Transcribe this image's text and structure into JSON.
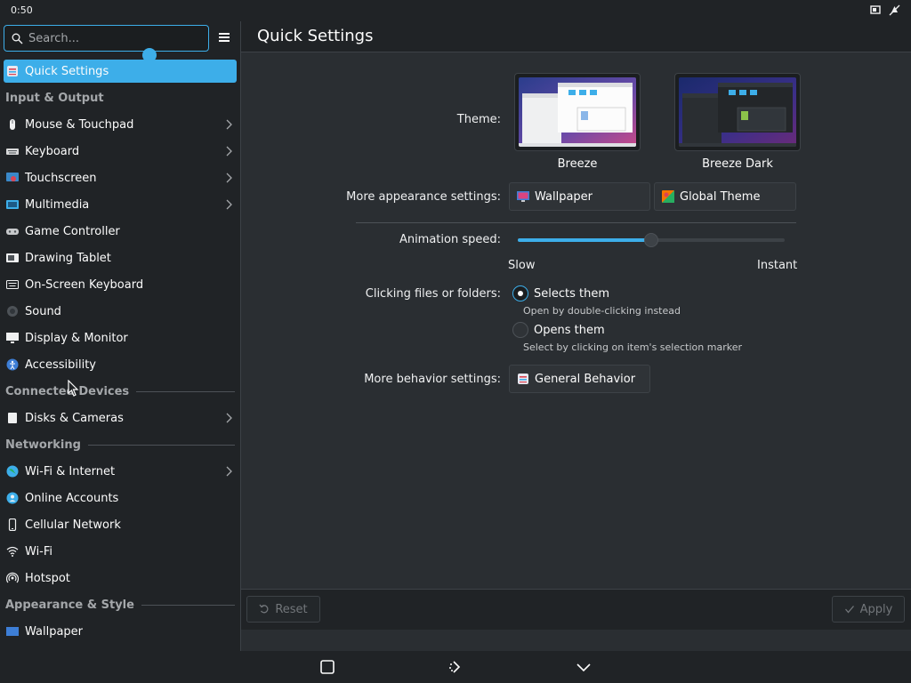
{
  "status": {
    "time": "0:50",
    "tray": [
      "screen-icon",
      "bell-off-icon"
    ]
  },
  "sidebar": {
    "search_placeholder": "Search...",
    "selected": {
      "label": "Quick Settings",
      "icon": "quick-settings-icon"
    },
    "sections": [
      {
        "header": "Input & Output",
        "items": [
          {
            "label": "Mouse & Touchpad",
            "icon": "mouse-icon",
            "chevron": true
          },
          {
            "label": "Keyboard",
            "icon": "keyboard-icon",
            "chevron": true
          },
          {
            "label": "Touchscreen",
            "icon": "touchscreen-icon",
            "chevron": true
          },
          {
            "label": "Multimedia",
            "icon": "multimedia-icon",
            "chevron": true
          },
          {
            "label": "Game Controller",
            "icon": "gamepad-icon",
            "chevron": false
          },
          {
            "label": "Drawing Tablet",
            "icon": "tablet-icon",
            "chevron": false
          },
          {
            "label": "On-Screen Keyboard",
            "icon": "onscreen-keyboard-icon",
            "chevron": false
          },
          {
            "label": "Sound",
            "icon": "speaker-icon",
            "chevron": false
          },
          {
            "label": "Display & Monitor",
            "icon": "monitor-icon",
            "chevron": false
          },
          {
            "label": "Accessibility",
            "icon": "accessibility-icon",
            "chevron": false
          }
        ]
      },
      {
        "header": "Connected Devices",
        "items": [
          {
            "label": "Disks & Cameras",
            "icon": "disk-icon",
            "chevron": true
          }
        ]
      },
      {
        "header": "Networking",
        "items": [
          {
            "label": "Wi-Fi & Internet",
            "icon": "globe-icon",
            "chevron": true
          },
          {
            "label": "Online Accounts",
            "icon": "online-accounts-icon",
            "chevron": false
          },
          {
            "label": "Cellular Network",
            "icon": "phone-icon",
            "chevron": false
          },
          {
            "label": "Wi-Fi",
            "icon": "wifi-icon",
            "chevron": false
          },
          {
            "label": "Hotspot",
            "icon": "hotspot-icon",
            "chevron": false
          }
        ]
      },
      {
        "header": "Appearance & Style",
        "items": [
          {
            "label": "Wallpaper",
            "icon": "wallpaper-icon",
            "chevron": false
          }
        ]
      }
    ]
  },
  "main": {
    "title": "Quick Settings",
    "theme_label": "Theme:",
    "themes": [
      {
        "name": "Breeze"
      },
      {
        "name": "Breeze Dark"
      }
    ],
    "appearance_label": "More appearance settings:",
    "wallpaper_button": "Wallpaper",
    "global_theme_button": "Global Theme",
    "animation_label": "Animation speed:",
    "animation_value": 0.5,
    "slow_label": "Slow",
    "instant_label": "Instant",
    "clicking_label": "Clicking files or folders:",
    "option_select": "Selects them",
    "option_select_help": "Open by double-clicking instead",
    "option_open": "Opens them",
    "option_open_help": "Select by clicking on item's selection marker",
    "behavior_label": "More behavior settings:",
    "general_behavior_button": "General Behavior"
  },
  "footer": {
    "reset": "Reset",
    "apply": "Apply"
  },
  "colors": {
    "accent": "#3daee9",
    "background": "#2a2e32",
    "sidebar": "#202326"
  }
}
